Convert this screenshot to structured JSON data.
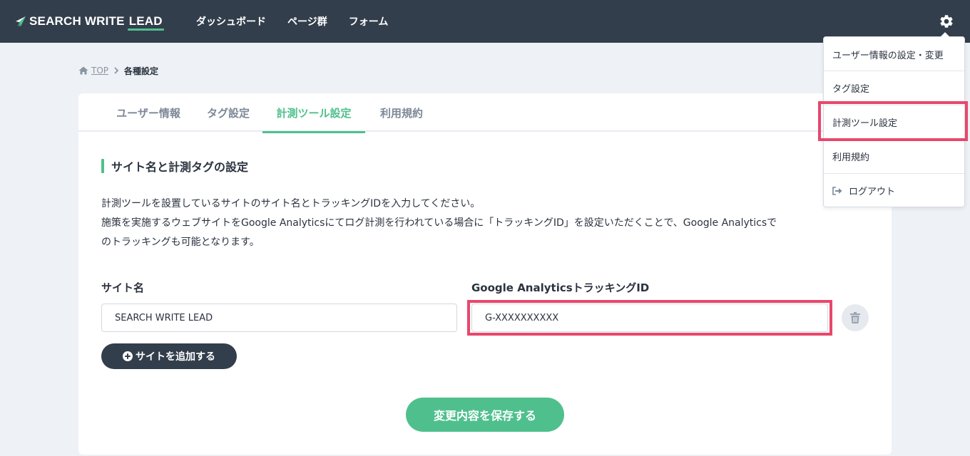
{
  "header": {
    "logo_text": "SEARCH WRITE",
    "logo_accent": "LEAD",
    "nav": [
      "ダッシュボード",
      "ページ群",
      "フォーム"
    ],
    "settings_icon": "gear-icon"
  },
  "dropdown": {
    "items": [
      "ユーザー情報の設定・変更",
      "タグ設定",
      "計測ツール設定",
      "利用規約",
      "ログアウト"
    ],
    "logout_icon": "sign-out-icon"
  },
  "breadcrumb": {
    "home_icon": "home-icon",
    "top": "TOP",
    "current": "各種設定"
  },
  "tabs": [
    "ユーザー情報",
    "タグ設定",
    "計測ツール設定",
    "利用規約"
  ],
  "active_tab": "計測ツール設定",
  "section": {
    "title": "サイト名と計測タグの設定",
    "description": [
      "計測ツールを設置しているサイトのサイト名とトラッキングIDを入力してください。",
      "施策を実施するウェブサイトをGoogle Analyticsにてログ計測を行われている場合に「トラッキングID」を設定いただくことで、Google Analyticsで",
      "のトラッキングも可能となります。"
    ]
  },
  "form": {
    "site_name_label": "サイト名",
    "site_name_value": "SEARCH WRITE LEAD",
    "tracking_label": "Google AnalyticsトラッキングID",
    "tracking_value": "G-XXXXXXXXXX",
    "delete_icon": "trash-icon",
    "add_button": "サイトを追加する",
    "save_button": "変更内容を保存する"
  },
  "colors": {
    "header_bg": "#333e4c",
    "accent": "#4fc08d",
    "highlight": "#e8476b",
    "page_bg": "#eef1f5"
  }
}
